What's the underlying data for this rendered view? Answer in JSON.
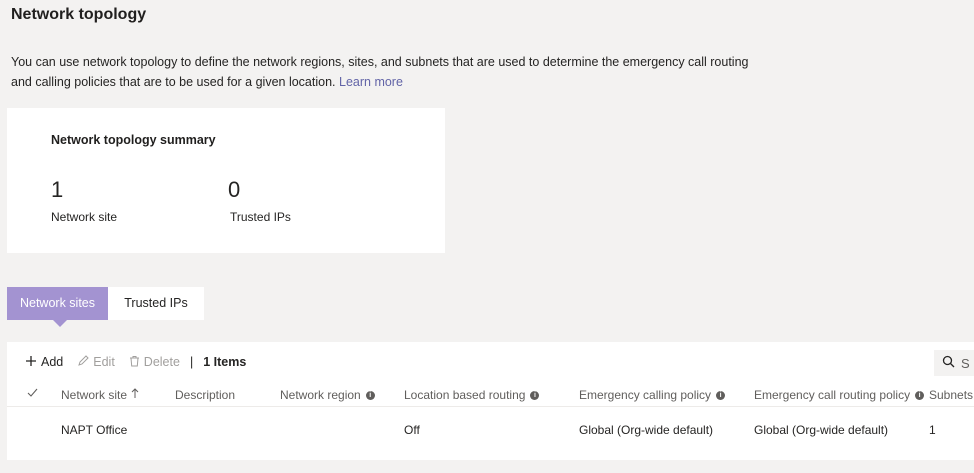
{
  "page": {
    "title": "Network topology",
    "description": "You can use network topology to define the network regions, sites, and subnets that are used to determine the emergency call routing and calling policies that are to be used for a given location.",
    "learn_more": "Learn more"
  },
  "summary": {
    "title": "Network topology summary",
    "stats": [
      {
        "value": "1",
        "label": "Network site"
      },
      {
        "value": "0",
        "label": "Trusted IPs"
      }
    ]
  },
  "tabs": [
    {
      "label": "Network sites",
      "active": true
    },
    {
      "label": "Trusted IPs",
      "active": false
    }
  ],
  "toolbar": {
    "add": "Add",
    "edit": "Edit",
    "delete": "Delete",
    "separator": "|",
    "count": "1 Items",
    "search_placeholder": "S"
  },
  "table": {
    "columns": [
      {
        "label": "Network site",
        "sort": "ascending"
      },
      {
        "label": "Description"
      },
      {
        "label": "Network region",
        "info": true
      },
      {
        "label": "Location based routing",
        "info": true
      },
      {
        "label": "Emergency calling policy",
        "info": true
      },
      {
        "label": "Emergency call routing policy",
        "info": true
      },
      {
        "label": "Subnets"
      }
    ],
    "rows": [
      [
        "NAPT Office",
        "",
        "",
        "Off",
        "Global (Org-wide default)",
        "Global (Org-wide default)",
        "1"
      ]
    ]
  },
  "colors": {
    "accent": "#a393d1",
    "link": "#6264a7",
    "background": "#f3f2f1"
  }
}
